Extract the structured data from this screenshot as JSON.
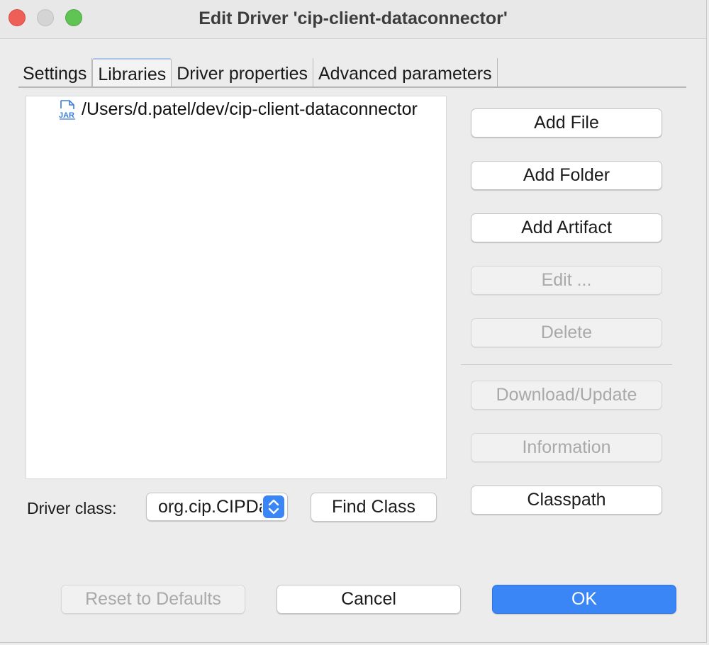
{
  "window": {
    "title": "Edit Driver 'cip-client-dataconnector'"
  },
  "tabs": [
    {
      "label": "Settings",
      "active": false
    },
    {
      "label": "Libraries",
      "active": true
    },
    {
      "label": "Driver properties",
      "active": false
    },
    {
      "label": "Advanced parameters",
      "active": false
    }
  ],
  "libraries": {
    "items": [
      {
        "icon": "jar-file-icon",
        "icon_text": "JAR",
        "path": "/Users/d.patel/dev/cip-client-dataconnector"
      }
    ]
  },
  "side_buttons": {
    "add_file": "Add File",
    "add_folder": "Add Folder",
    "add_artifact": "Add Artifact",
    "edit": "Edit ...",
    "delete": "Delete",
    "download_update": "Download/Update",
    "information": "Information",
    "classpath": "Classpath"
  },
  "driver_class": {
    "label": "Driver class:",
    "value": "org.cip.CIPDataConnectorDriver",
    "find_class_label": "Find Class"
  },
  "footer": {
    "reset_label": "Reset to Defaults",
    "cancel_label": "Cancel",
    "ok_label": "OK"
  },
  "colors": {
    "accent": "#3a86f7",
    "close": "#ee5f58",
    "zoom": "#5fc453",
    "minimize_inactive": "#d4d4d4",
    "disabled_text": "#a9a9a9"
  }
}
